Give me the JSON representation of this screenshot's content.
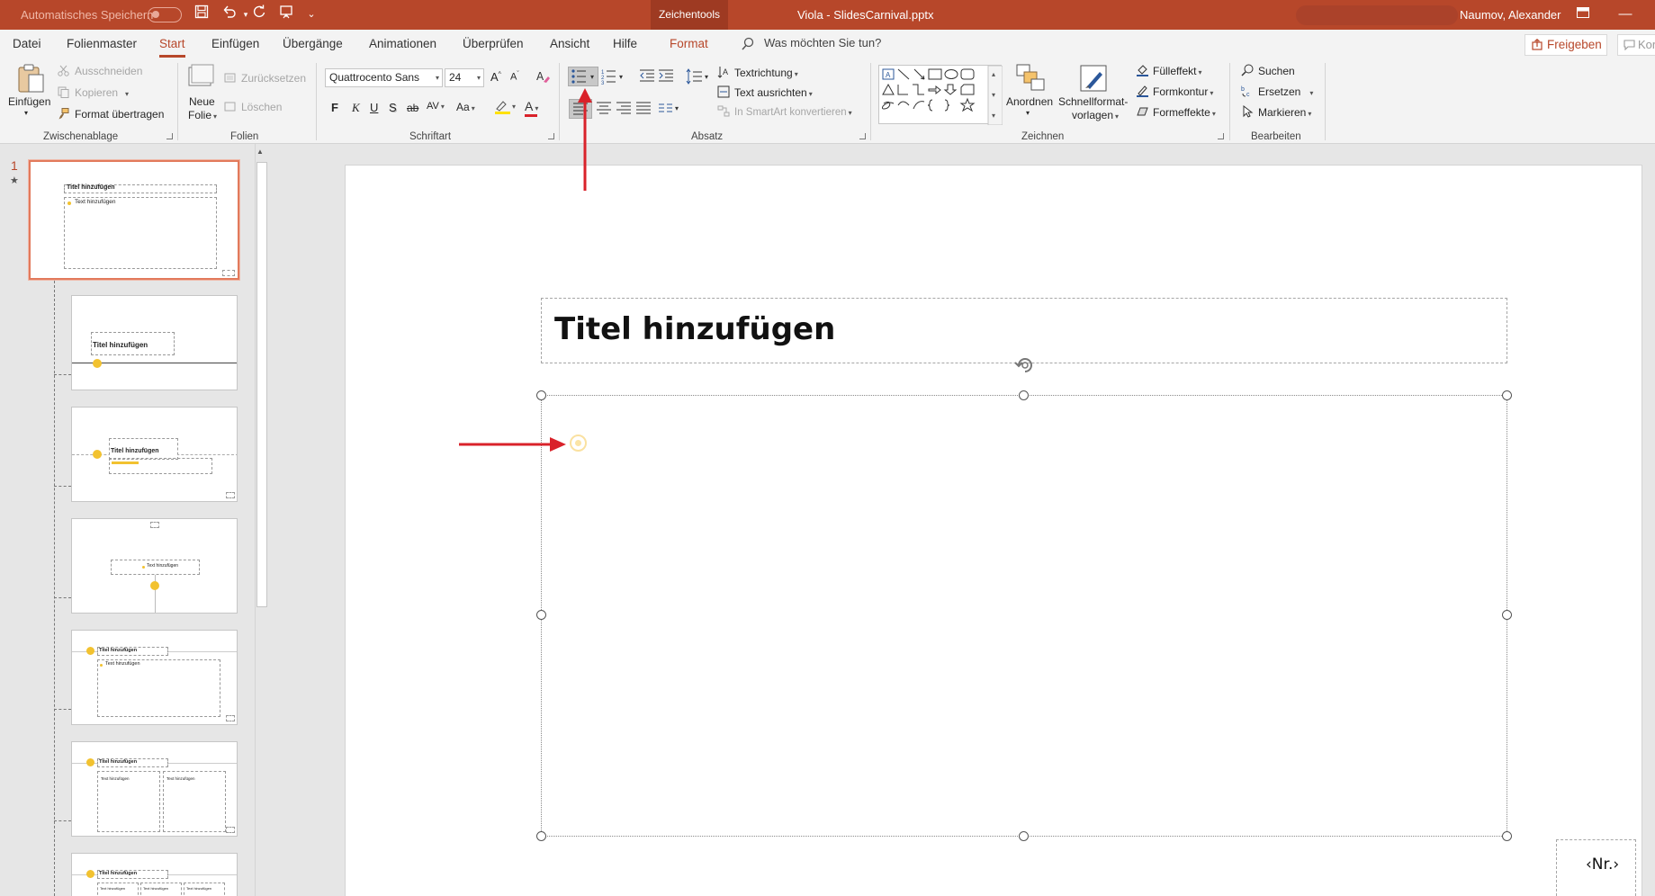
{
  "titlebar": {
    "autosave_label": "Automatisches Speichern",
    "context_tab": "Zeichentools",
    "document_title": "Viola - SlidesCarnival.pptx",
    "user_name": "Naumov, Alexander",
    "bg_color": "#b7472a"
  },
  "menu": {
    "items": [
      "Datei",
      "Folienmaster",
      "Start",
      "Einfügen",
      "Übergänge",
      "Animationen",
      "Überprüfen",
      "Ansicht",
      "Hilfe",
      "Format"
    ],
    "active": "Start",
    "tell_me": "Was möchten Sie tun?",
    "share": "Freigeben",
    "comments": "Kor"
  },
  "ribbon": {
    "clipboard": {
      "paste": "Einfügen",
      "cut": "Ausschneiden",
      "copy": "Kopieren",
      "format_painter": "Format übertragen",
      "label": "Zwischenablage"
    },
    "slides": {
      "new_slide_1": "Neue",
      "new_slide_2": "Folie",
      "reset": "Zurücksetzen",
      "delete": "Löschen",
      "label": "Folien"
    },
    "font": {
      "name": "Quattrocento Sans",
      "size": "24",
      "bold": "F",
      "italic": "K",
      "underline": "U",
      "shadow": "S",
      "strike": "ab",
      "spacing": "AV",
      "case": "Aa",
      "grow": "A",
      "shrink": "A",
      "color_letter": "A",
      "label": "Schriftart"
    },
    "paragraph": {
      "text_direction": "Textrichtung",
      "align_text": "Text ausrichten",
      "smartart": "In SmartArt konvertieren",
      "label": "Absatz"
    },
    "drawing": {
      "arrange": "Anordnen",
      "quick_styles_1": "Schnellformat-",
      "quick_styles_2": "vorlagen",
      "fill": "Fülleffekt",
      "outline": "Formkontur",
      "effects": "Formeffekte",
      "label": "Zeichnen"
    },
    "editing": {
      "find": "Suchen",
      "replace": "Ersetzen",
      "select": "Markieren",
      "label": "Bearbeiten"
    }
  },
  "thumbnails": {
    "selected_number": "1",
    "star": "★",
    "t1_title": "Titel hinzufügen",
    "t1_text": "Text hinzufügen",
    "t2_title": "Titel hinzufügen",
    "t3_title": "Titel hinzufügen",
    "t4_text": "Text hinzufügen",
    "t5_title": "Titel hinzufügen",
    "t5_text": "Text hinzufügen",
    "t6_title": "Titel hinzufügen",
    "t6_text_a": "Text hinzufügen",
    "t6_text_b": "Text hinzufügen",
    "t7_title": "Titel hinzufügen",
    "t7_text_a": "Text hinzufügen",
    "t7_text_b": "Text hinzufügen",
    "t7_text_c": "Text hinzufügen"
  },
  "slide": {
    "title_placeholder": "Titel hinzufügen",
    "number_placeholder": "‹Nr.›",
    "bullet_color": "#fbe4a6"
  },
  "annotations": {
    "arrow_color": "#d9222a"
  }
}
